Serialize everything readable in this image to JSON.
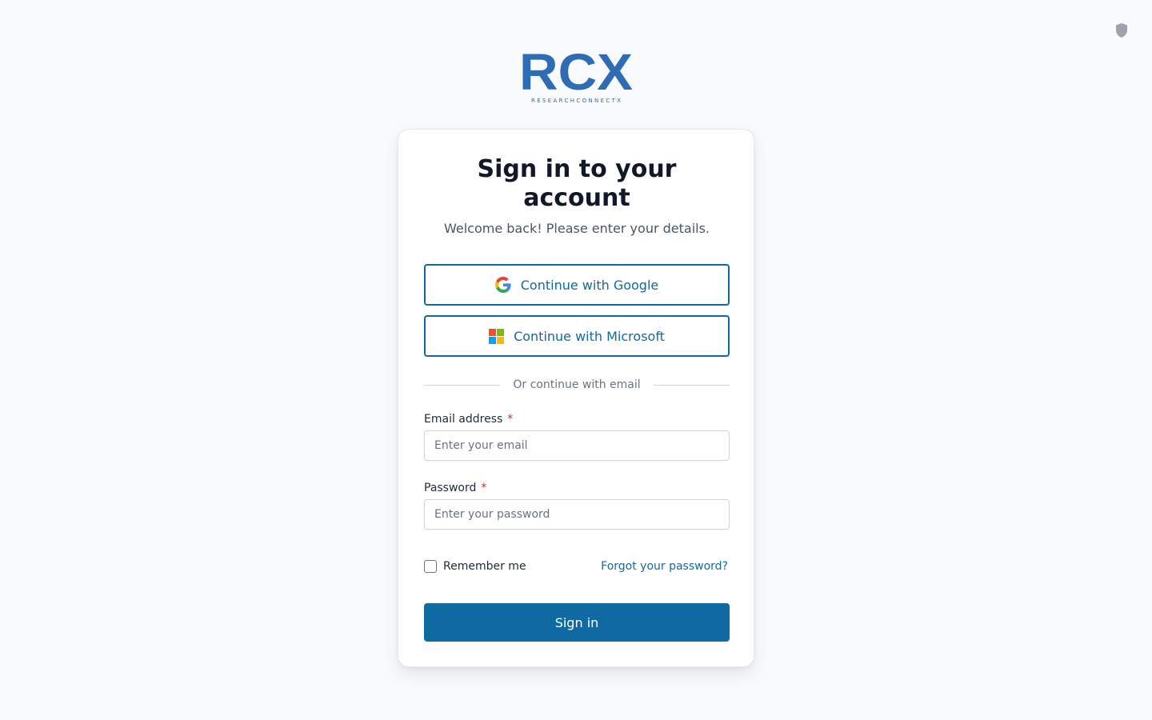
{
  "header": {
    "shield_icon": "shield-icon",
    "logo": {
      "main": "RCX",
      "tagline": "RESEARCHCONNECTX",
      "color": "#2e6db3"
    }
  },
  "card": {
    "title": "Sign in to your account",
    "subtitle": "Welcome back! Please enter your details.",
    "sso": {
      "google_label": "Continue with Google",
      "microsoft_label": "Continue with Microsoft"
    },
    "divider_text": "Or continue with email",
    "email": {
      "label": "Email address",
      "required": "*",
      "placeholder": "Enter your email",
      "value": ""
    },
    "password": {
      "label": "Password",
      "required": "*",
      "placeholder": "Enter your password",
      "value": ""
    },
    "remember_label": "Remember me",
    "remember_checked": false,
    "forgot_label": "Forgot your password?",
    "submit_label": "Sign in"
  },
  "colors": {
    "accent": "#0e6aa1",
    "required": "#dc2626",
    "background": "#f8fafc"
  }
}
